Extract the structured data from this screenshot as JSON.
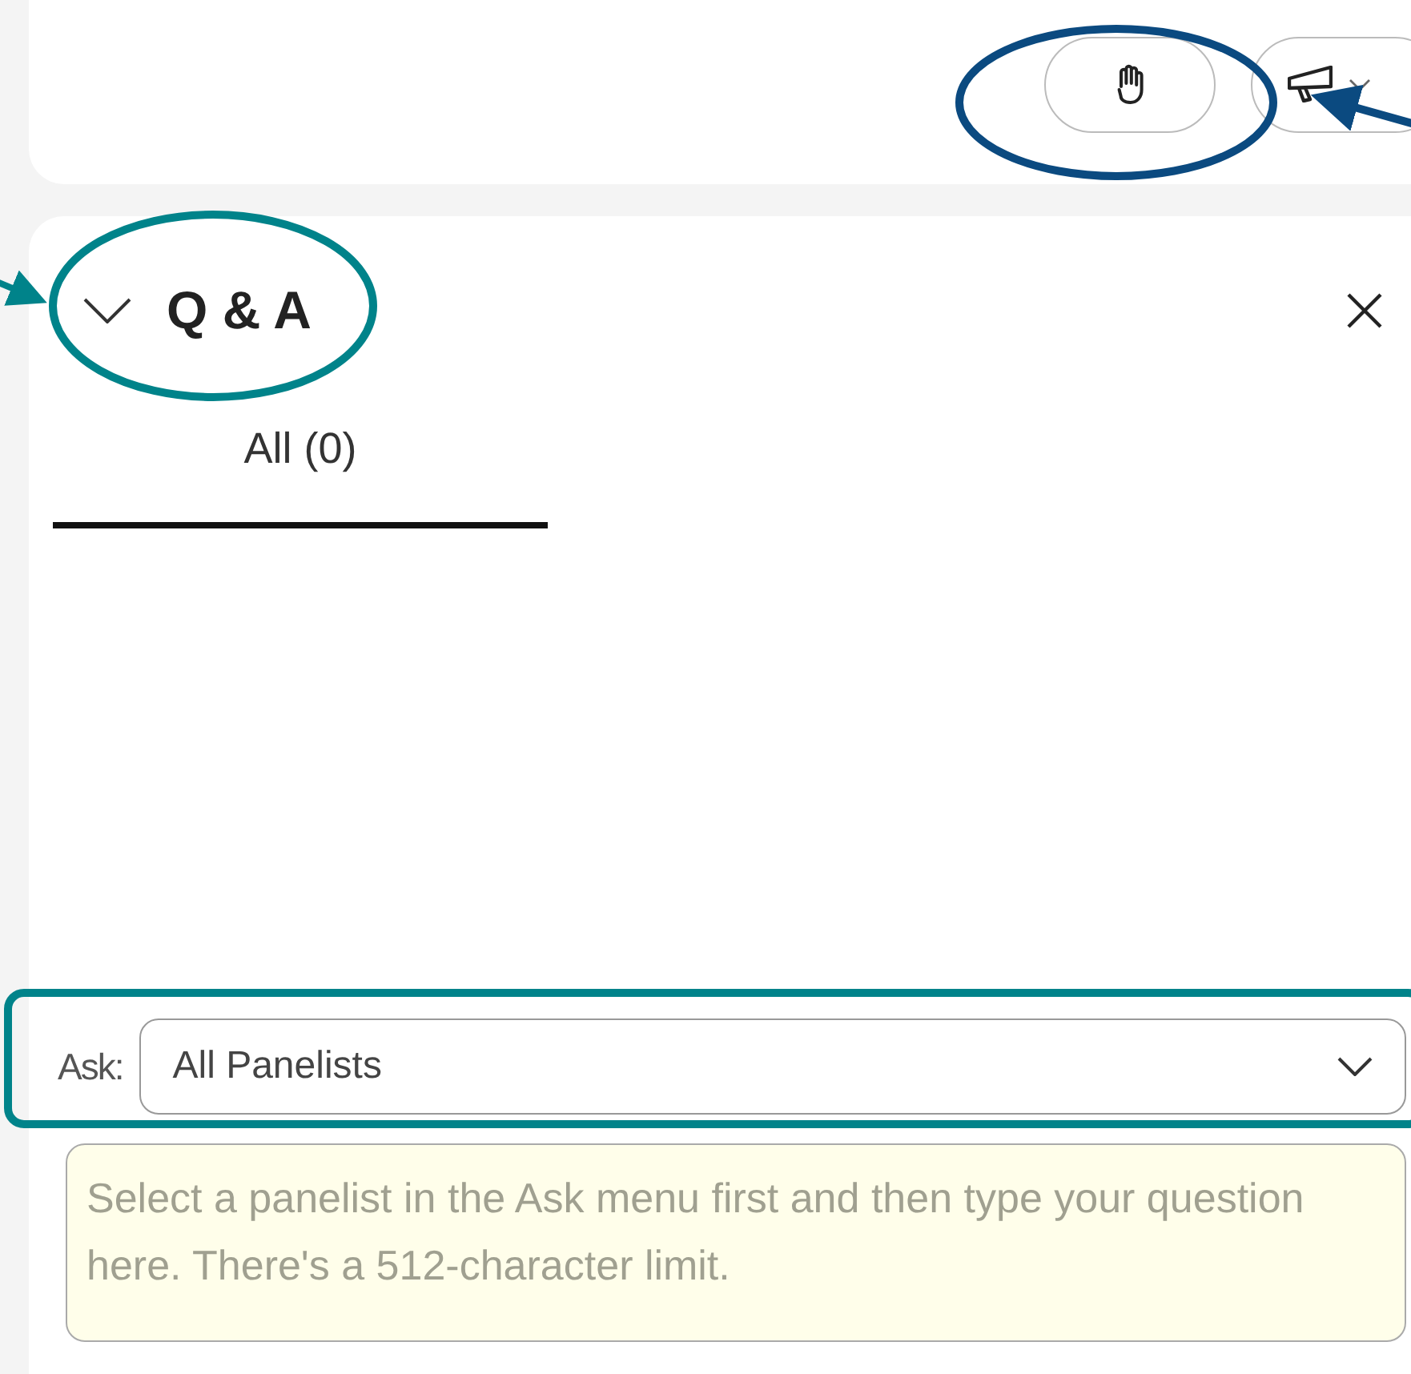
{
  "toolbar": {
    "buttons": [
      {
        "kind": "raise-hand"
      },
      {
        "kind": "reaction-menu"
      }
    ]
  },
  "panel": {
    "title": "Q & A",
    "expanded": true,
    "tabs": [
      {
        "label": "All (0)",
        "selected": true
      }
    ],
    "ask": {
      "label": "Ask:",
      "value": "All Panelists"
    },
    "question": {
      "placeholder": "Select a panelist in the Ask menu first and then type your question here. There's a 512-character limit."
    }
  }
}
